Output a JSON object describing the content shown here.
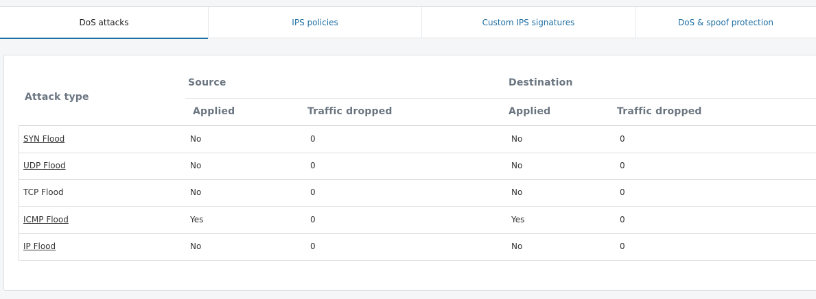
{
  "tabs": [
    {
      "label": "DoS attacks",
      "active": true
    },
    {
      "label": "IPS policies",
      "active": false
    },
    {
      "label": "Custom IPS signatures",
      "active": false
    },
    {
      "label": "DoS & spoof protection",
      "active": false
    }
  ],
  "table": {
    "header": {
      "attack_type": "Attack type",
      "source": "Source",
      "destination": "Destination",
      "source_applied": "Applied",
      "source_dropped": "Traffic dropped",
      "dest_applied": "Applied",
      "dest_dropped": "Traffic dropped"
    },
    "rows": [
      {
        "attack": "SYN Flood",
        "link": true,
        "src_applied": "No",
        "src_dropped": "0",
        "dst_applied": "No",
        "dst_dropped": "0"
      },
      {
        "attack": "UDP Flood",
        "link": true,
        "src_applied": "No",
        "src_dropped": "0",
        "dst_applied": "No",
        "dst_dropped": "0"
      },
      {
        "attack": "TCP Flood",
        "link": false,
        "src_applied": "No",
        "src_dropped": "0",
        "dst_applied": "No",
        "dst_dropped": "0"
      },
      {
        "attack": "ICMP Flood",
        "link": true,
        "src_applied": "Yes",
        "src_dropped": "0",
        "dst_applied": "Yes",
        "dst_dropped": "0"
      },
      {
        "attack": "IP Flood",
        "link": true,
        "src_applied": "No",
        "src_dropped": "0",
        "dst_applied": "No",
        "dst_dropped": "0"
      }
    ]
  },
  "colors": {
    "accent": "#1f6fa3",
    "header_text": "#6b7580"
  }
}
